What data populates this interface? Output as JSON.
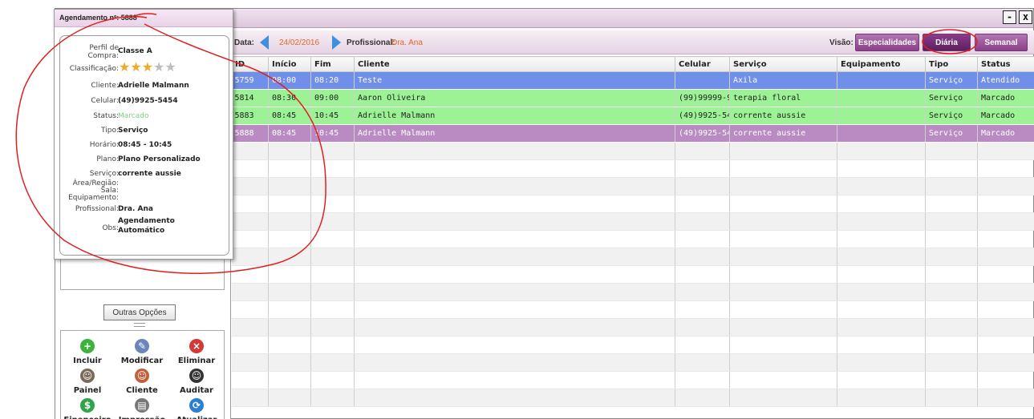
{
  "toolbar": {
    "date_label": "Data:",
    "date_value": "24/02/2016",
    "professional_label": "Profissional:",
    "professional_value": "Dra. Ana",
    "view_label": "Visão:",
    "view_buttons": [
      "Especialidades",
      "Diária",
      "Semanal"
    ],
    "active_view": "Diária"
  },
  "window": {
    "minimize_glyph": "-",
    "close_glyph": "x"
  },
  "table": {
    "columns": [
      "ID",
      "Início",
      "Fim",
      "Cliente",
      "Celular",
      "Serviço",
      "Equipamento",
      "Tipo",
      "Status"
    ],
    "rows": [
      {
        "id": "5759",
        "inicio": "08:00",
        "fim": "08:20",
        "cliente": "Teste",
        "celular": "",
        "servico": "Axila",
        "equipamento": "",
        "tipo": "Serviço",
        "status": "Atendido",
        "color": "#6f8fe8"
      },
      {
        "id": "5814",
        "inicio": "08:30",
        "fim": "09:00",
        "cliente": "Aaron Oliveira",
        "celular": "(99)99999-9",
        "servico": "terapia floral",
        "equipamento": "",
        "tipo": "Serviço",
        "status": "Marcado",
        "color": "#9cf294"
      },
      {
        "id": "5883",
        "inicio": "08:45",
        "fim": "10:45",
        "cliente": "Adrielle Malmann",
        "celular": "(49)9925-54",
        "servico": "corrente aussie",
        "equipamento": "",
        "tipo": "Serviço",
        "status": "Marcado",
        "color": "#9cf294"
      },
      {
        "id": "5888",
        "inicio": "08:45",
        "fim": "10:45",
        "cliente": "Adrielle Malmann",
        "celular": "(49)9925-54",
        "servico": "corrente aussie",
        "equipamento": "",
        "tipo": "Serviço",
        "status": "Marcado",
        "color": "#b98bc2"
      }
    ]
  },
  "left_panel": {
    "more_options_label": "Outras Opções",
    "actions": [
      {
        "label": "Incluir",
        "icon": "add-icon",
        "glyph": "+",
        "color": "#3db23d"
      },
      {
        "label": "Modificar",
        "icon": "edit-icon",
        "glyph": "✎",
        "color": "#6b86b8"
      },
      {
        "label": "Eliminar",
        "icon": "delete-icon",
        "glyph": "×",
        "color": "#d23a3a"
      },
      {
        "label": "Painel",
        "icon": "panel-person-icon",
        "glyph": "☺",
        "color": "#7a6a5a"
      },
      {
        "label": "Cliente",
        "icon": "client-person-icon",
        "glyph": "☺",
        "color": "#c0603a"
      },
      {
        "label": "Auditar",
        "icon": "audit-person-icon",
        "glyph": "☺",
        "color": "#333333"
      },
      {
        "label": "Financeiro",
        "icon": "finance-icon",
        "glyph": "$",
        "color": "#2fa44a"
      },
      {
        "label": "Impressão",
        "icon": "printer-icon",
        "glyph": "▤",
        "color": "#777777"
      },
      {
        "label": "Atualizar",
        "icon": "refresh-icon",
        "glyph": "⟳",
        "color": "#2a7fd0"
      }
    ]
  },
  "popup": {
    "title": "Agendamento nº: 5888",
    "fields": {
      "perfil_label": "Perfil de Compra:",
      "perfil_value": "Classe A",
      "classificacao_label": "Classificação:",
      "rating": 3,
      "rating_max": 5,
      "cliente_label": "Cliente:",
      "cliente_value": "Adrielle Malmann",
      "celular_label": "Celular:",
      "celular_value": "(49)9925-5454",
      "status_label": "Status:",
      "status_value": "Marcado",
      "tipo_label": "Tipo:",
      "tipo_value": "Serviço",
      "horario_label": "Horário:",
      "horario_value": "08:45 - 10:45",
      "plano_label": "Plano:",
      "plano_value": "Plano Personalizado",
      "servico_label": "Serviço:",
      "servico_value": "corrente aussie",
      "area_label": "Área/Região:",
      "sala_label": "Sala:",
      "equipamento_label": "Equipamento:",
      "profissional_label": "Profissional:",
      "profissional_value": "Dra. Ana",
      "obs_label": "Obs:",
      "obs_value": "Agendamento Automático"
    }
  },
  "colors": {
    "accent": "#8a3f8a",
    "date_orange": "#e8632a",
    "arrow_blue": "#3f8fe0",
    "status_green": "#7ed07e",
    "annotation_red": "#e02020"
  }
}
